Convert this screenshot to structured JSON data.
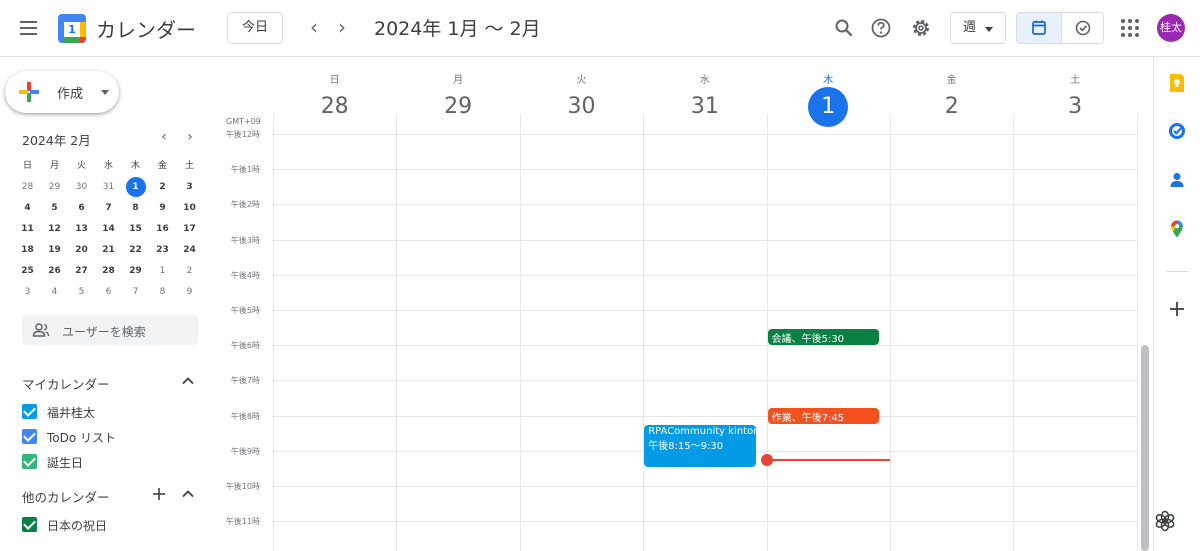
{
  "app": {
    "title": "カレンダー",
    "logo_day": "1",
    "menu_icon": "hamburger-menu-icon"
  },
  "toolbar": {
    "today_label": "今日",
    "prev_icon": "chevron-left-icon",
    "next_icon": "chevron-right-icon",
    "prev_glyph": "‹",
    "next_glyph": "›",
    "date_range": "2024年 1月 〜 2月",
    "view_label": "週",
    "avatar_text": "桂太",
    "avatar_color": "#9c27b0"
  },
  "sidebar": {
    "create_label": "作成",
    "mini": {
      "title": "2024年 2月",
      "prev_glyph": "‹",
      "next_glyph": "›",
      "weekdays": [
        "日",
        "月",
        "火",
        "水",
        "木",
        "金",
        "土"
      ],
      "weeks": [
        [
          {
            "d": "28",
            "s": "dim"
          },
          {
            "d": "29",
            "s": "dim"
          },
          {
            "d": "30",
            "s": "dim"
          },
          {
            "d": "31",
            "s": "dim"
          },
          {
            "d": "1",
            "s": "today"
          },
          {
            "d": "2",
            "s": "bold"
          },
          {
            "d": "3",
            "s": "bold"
          }
        ],
        [
          {
            "d": "4",
            "s": "bold"
          },
          {
            "d": "5",
            "s": "bold"
          },
          {
            "d": "6",
            "s": "bold"
          },
          {
            "d": "7",
            "s": "bold"
          },
          {
            "d": "8",
            "s": "bold"
          },
          {
            "d": "9",
            "s": "bold"
          },
          {
            "d": "10",
            "s": "bold"
          }
        ],
        [
          {
            "d": "11",
            "s": "bold"
          },
          {
            "d": "12",
            "s": "bold"
          },
          {
            "d": "13",
            "s": "bold"
          },
          {
            "d": "14",
            "s": "bold"
          },
          {
            "d": "15",
            "s": "bold"
          },
          {
            "d": "16",
            "s": "bold"
          },
          {
            "d": "17",
            "s": "bold"
          }
        ],
        [
          {
            "d": "18",
            "s": "bold"
          },
          {
            "d": "19",
            "s": "bold"
          },
          {
            "d": "20",
            "s": "bold"
          },
          {
            "d": "21",
            "s": "bold"
          },
          {
            "d": "22",
            "s": "bold"
          },
          {
            "d": "23",
            "s": "bold"
          },
          {
            "d": "24",
            "s": "bold"
          }
        ],
        [
          {
            "d": "25",
            "s": "bold"
          },
          {
            "d": "26",
            "s": "bold"
          },
          {
            "d": "27",
            "s": "bold"
          },
          {
            "d": "28",
            "s": "bold"
          },
          {
            "d": "29",
            "s": "bold"
          },
          {
            "d": "1",
            "s": "dim"
          },
          {
            "d": "2",
            "s": "dim"
          }
        ],
        [
          {
            "d": "3",
            "s": "dim"
          },
          {
            "d": "4",
            "s": "dim"
          },
          {
            "d": "5",
            "s": "dim"
          },
          {
            "d": "6",
            "s": "dim"
          },
          {
            "d": "7",
            "s": "dim"
          },
          {
            "d": "8",
            "s": "dim"
          },
          {
            "d": "9",
            "s": "dim"
          }
        ]
      ]
    },
    "search_placeholder": "ユーザーを検索",
    "my_calendars": {
      "title": "マイカレンダー",
      "items": [
        {
          "name": "福井桂太",
          "color": "#039be5"
        },
        {
          "name": "ToDo リスト",
          "color": "#4285f4"
        },
        {
          "name": "誕生日",
          "color": "#33b679"
        }
      ]
    },
    "other_calendars": {
      "title": "他のカレンダー",
      "items": [
        {
          "name": "日本の祝日",
          "color": "#0b8043"
        }
      ]
    }
  },
  "week": {
    "timezone": "GMT+09",
    "days": [
      {
        "dow": "日",
        "date": "28",
        "today": false
      },
      {
        "dow": "月",
        "date": "29",
        "today": false
      },
      {
        "dow": "火",
        "date": "30",
        "today": false
      },
      {
        "dow": "水",
        "date": "31",
        "today": false
      },
      {
        "dow": "木",
        "date": "1",
        "today": true
      },
      {
        "dow": "金",
        "date": "2",
        "today": false
      },
      {
        "dow": "土",
        "date": "3",
        "today": false
      }
    ],
    "hours": [
      "午後12時",
      "午後1時",
      "午後2時",
      "午後3時",
      "午後4時",
      "午後5時",
      "午後6時",
      "午後7時",
      "午後8時",
      "午後9時",
      "午後10時",
      "午後11時"
    ],
    "first_hour": 12,
    "events": [
      {
        "title": "会議、午後5:30",
        "day": 4,
        "start": 17.5,
        "end": 18.0,
        "color": "#0b8043",
        "lines": [
          "会議、午後5:30"
        ]
      },
      {
        "title": "作業、午後7:45",
        "day": 4,
        "start": 19.75,
        "end": 20.25,
        "color": "#f4511e",
        "lines": [
          "作業、午後7:45"
        ]
      },
      {
        "title": "RPACommunity kintone",
        "day": 3,
        "start": 20.25,
        "end": 21.5,
        "color": "#039be5",
        "lines": [
          "RPACommunity kintone",
          "午後8:15〜9:30"
        ]
      }
    ],
    "now": {
      "day": 4,
      "hour": 21.25,
      "color": "#ea4335"
    }
  },
  "side_panel": {
    "icons": [
      "keep-icon",
      "tasks-icon",
      "contacts-icon",
      "maps-icon"
    ],
    "add_icon": "plus-icon"
  }
}
